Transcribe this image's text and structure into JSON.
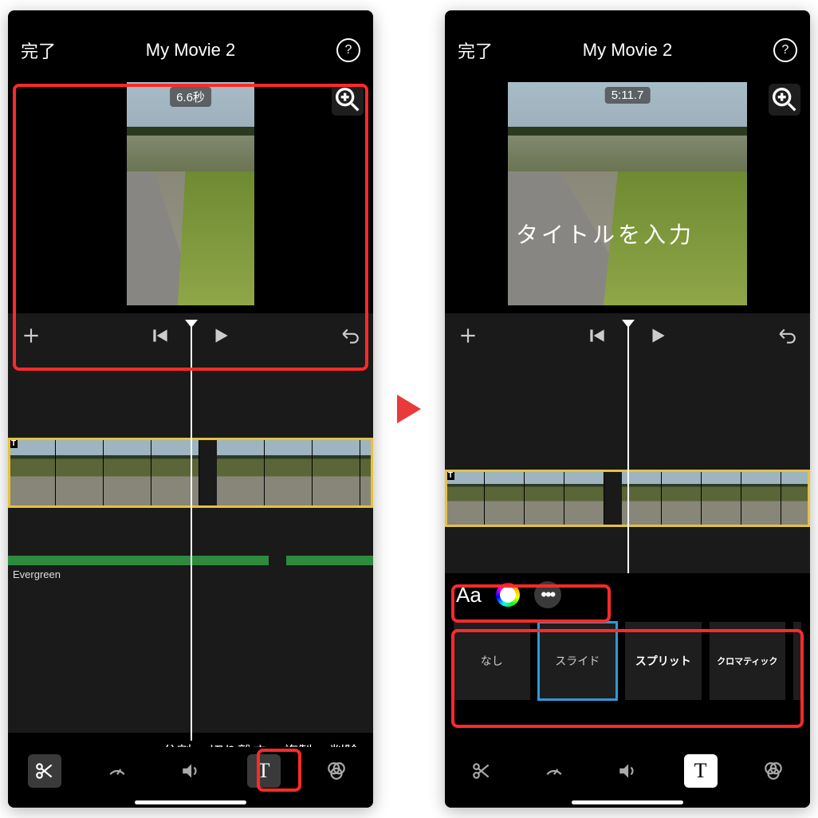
{
  "left": {
    "done": "完了",
    "title": "My Movie 2",
    "time_badge": "6.6秒",
    "audio_label": "Evergreen",
    "actions": {
      "split": "分割",
      "detach": "切り離す",
      "duplicate": "複製",
      "delete": "削除"
    }
  },
  "right": {
    "done": "完了",
    "title": "My Movie 2",
    "time_badge": "5:11.7",
    "title_overlay": "タイトルを入力",
    "format": {
      "aa": "Aa",
      "more": "•••"
    },
    "styles": {
      "none": "なし",
      "slide": "スライド",
      "split": "スプリット",
      "chromatic": "クロマティック"
    }
  }
}
